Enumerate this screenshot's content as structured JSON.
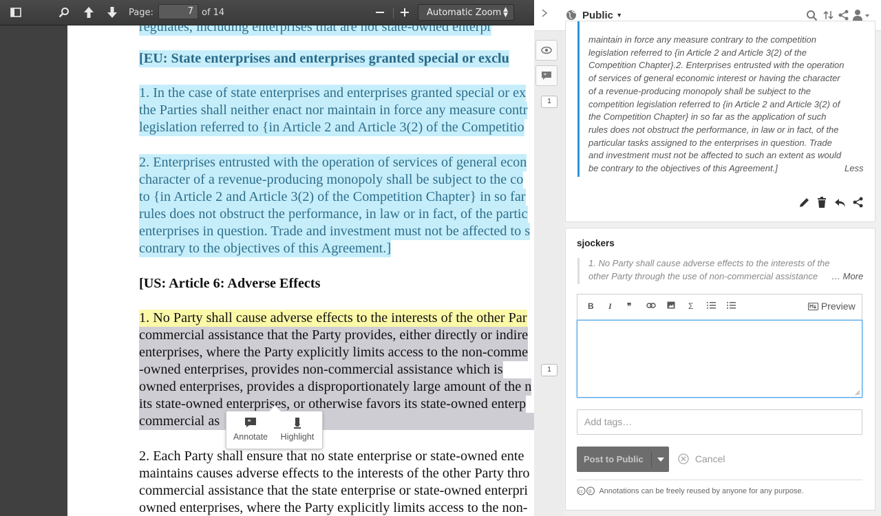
{
  "toolbar": {
    "page_label": "Page:",
    "page_value": "7",
    "page_total": "of 14",
    "zoom_minus": "—",
    "zoom_plus": "+",
    "zoom_value": "Automatic Zoom"
  },
  "document": {
    "line0": "regulates, including enterprises that are not state-owned enterpr",
    "eu_heading": "[EU: State enterprises and enterprises granted special or exclu",
    "eu_p1": [
      "1. In the case of state enterprises and enterprises granted special or ex",
      "the Parties shall neither enact nor maintain in force any measure contr",
      "legislation referred to {in Article 2 and Article 3(2) of the Competitio"
    ],
    "eu_p2": [
      "2. Enterprises entrusted with the operation of services of general econ",
      "character of a revenue-producing monopoly shall be subject to the co",
      "to {in Article 2 and Article 3(2) of the Competition Chapter} in so far",
      "rules does not obstruct the performance, in law or in fact, of the partic",
      "enterprises in question. Trade and investment must not be affected to s",
      "contrary to the objectives of this Agreement.]"
    ],
    "us_heading": "[US: Article 6: Adverse Effects",
    "us_p1_first": "1. No Party shall cause adverse effects to the interests of the other Par",
    "us_p1": [
      "commercial assistance that the Party provides, either directly or indire",
      "enterprises, where the Party explicitly limits access to the non-comme",
      "-owned enterprises, provides non-commercial assistance which is",
      "owned enterprises, provides a disproportionately large amount of the n",
      "its state-owned enterprises, or otherwise favors its state-owned enterp",
      "commercial as"
    ],
    "us_p2": [
      "2. Each Party shall ensure that no state enterprise or state-owned ente",
      "maintains causes adverse effects to the interests of the other Party thro",
      "commercial assistance that the state enterprise or state-owned enterpri",
      "owned enterprises, where the Party explicitly limits access to the non-"
    ]
  },
  "popup": {
    "annotate": "Annotate",
    "highlight": "Highlight"
  },
  "buckets": {
    "count_top": "1",
    "count_mid": "1"
  },
  "sidebar": {
    "group_name": "Public",
    "card1": {
      "quote_lines": [
        "maintain in force any measure contrary to the competition",
        "legislation referred to {in Article 2 and Article 3(2) of the",
        "Competition Chapter}.2. Enterprises entrusted with the operation",
        "of services of general economic interest or having the character",
        "of a revenue-producing monopoly shall be subject to the",
        "competition legislation referred to {in Article 2 and Article 3(2) of",
        "the Competition Chapter} in so far as the application of such",
        "rules does not obstruct the performance, in law or in fact, of the",
        "particular tasks assigned to the enterprises in question. Trade",
        "and investment must not be affected to such an extent as would",
        "be contrary to the objectives of this Agreement.]"
      ],
      "less": "Less"
    },
    "card2": {
      "user": "sjockers",
      "quote_lines": [
        "1. No Party shall cause adverse effects to the interests of the",
        "other Party through the use of non-commercial assistance"
      ],
      "more": "… More",
      "preview": "Preview",
      "tags_placeholder": "Add tags…",
      "post_label": "Post to Public",
      "cancel_label": "Cancel",
      "license": "Annotations can be freely reused by anyone for any purpose."
    }
  },
  "colors": {
    "highlight_blue": "#c6eefa",
    "highlight_yellow": "#fbf8a8",
    "selection_gray": "#cfcdd4",
    "accent": "#2f95d6"
  }
}
